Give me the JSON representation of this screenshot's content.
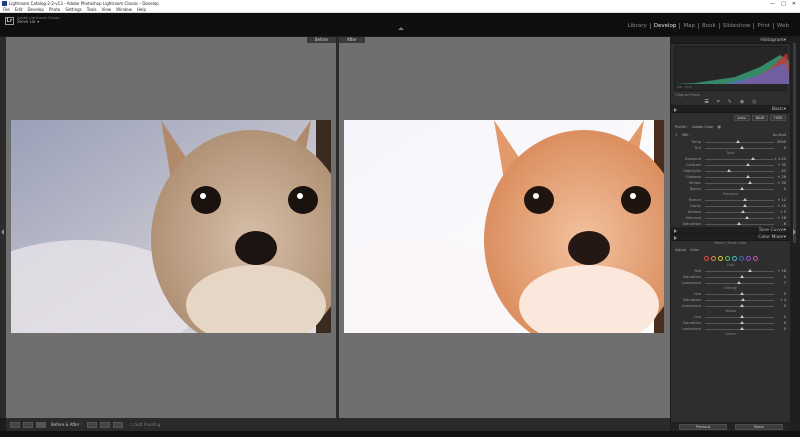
{
  "window": {
    "title": "Lightroom Catalog-2-2-v13 - Adobe Photoshop Lightroom Classic - Develop",
    "controls": [
      "—",
      "□",
      "✕"
    ]
  },
  "menu": [
    "File",
    "Edit",
    "Develop",
    "Photo",
    "Settings",
    "Tools",
    "View",
    "Window",
    "Help"
  ],
  "identity": {
    "logo": "Lr",
    "subtitle": "Adobe Lightroom Classic",
    "user": "Steve Lor"
  },
  "modules": [
    "Library",
    "Develop",
    "Map",
    "Book",
    "Slideshow",
    "Print",
    "Web"
  ],
  "active_module": "Develop",
  "view": {
    "before_label": "Before",
    "after_label": "After"
  },
  "toolbar": {
    "mode_label": "Before & After :",
    "soft_proof": "Soft Proofing"
  },
  "right_panel": {
    "histogram_title": "Histogram",
    "histogram_info_left": "ISO",
    "histogram_info_right": "f/2.8",
    "original_photo": "Original Photo",
    "basic_title": "Basic",
    "treatment": [
      "Auto",
      "B&W",
      "HDR"
    ],
    "profile_label": "Profile :",
    "profile_value": "Adobe Color",
    "wb_label": "WB :",
    "wb_value": "As Shot",
    "tone_label": "Tone",
    "presence_label": "Presence",
    "sliders": [
      {
        "label": "Temp",
        "value": "5500",
        "pos": 0.45
      },
      {
        "label": "Tint",
        "value": "0",
        "pos": 0.5
      },
      {
        "label": "Exposure",
        "value": "+ 1.25",
        "pos": 0.66
      },
      {
        "label": "Contrast",
        "value": "+ 32",
        "pos": 0.6
      },
      {
        "label": "Highlights",
        "value": "- 42",
        "pos": 0.32
      },
      {
        "label": "Shadows",
        "value": "+ 28",
        "pos": 0.6
      },
      {
        "label": "Whites",
        "value": "+ 30",
        "pos": 0.62
      },
      {
        "label": "Blacks",
        "value": "0",
        "pos": 0.5
      },
      {
        "label": "Texture",
        "value": "+ 12",
        "pos": 0.55
      },
      {
        "label": "Clarity",
        "value": "+ 10",
        "pos": 0.55
      },
      {
        "label": "Dehaze",
        "value": "+ 5",
        "pos": 0.52
      },
      {
        "label": "Vibrance",
        "value": "+ 18",
        "pos": 0.58
      },
      {
        "label": "Saturation",
        "value": "- 6",
        "pos": 0.47
      }
    ],
    "tone_curve_title": "Tone Curve",
    "color_mixer_title": "Color Mixer",
    "color_mixer_tabs": [
      "Mixer",
      "Point Color"
    ],
    "adjust_label": "Adjust",
    "adjust_value": "Color",
    "color_circles": [
      "#e04848",
      "#e38a3c",
      "#d8c83c",
      "#5ac24a",
      "#45b7c2",
      "#3b66d4",
      "#9a52d0",
      "#d24fb0"
    ],
    "hue_group": "Hue",
    "hue_rows": [
      {
        "label": "Red",
        "value": "+ 18",
        "pos": 0.62
      },
      {
        "label": "Saturation",
        "value": "0",
        "pos": 0.5
      },
      {
        "label": "Luminance",
        "value": "- 7",
        "pos": 0.46
      }
    ],
    "orange_group": "Orange",
    "orange_rows": [
      {
        "label": "Hue",
        "value": "0",
        "pos": 0.5
      },
      {
        "label": "Saturation",
        "value": "+ 4",
        "pos": 0.52
      },
      {
        "label": "Luminance",
        "value": "0",
        "pos": 0.5
      }
    ],
    "yellow_group": "Yellow",
    "yellow_rows": [
      {
        "label": "Hue",
        "value": "0",
        "pos": 0.5
      },
      {
        "label": "Saturation",
        "value": "0",
        "pos": 0.5
      },
      {
        "label": "Luminance",
        "value": "0",
        "pos": 0.5
      }
    ],
    "green_group": "Green",
    "previous_label": "Previous",
    "reset_label": "Reset"
  }
}
